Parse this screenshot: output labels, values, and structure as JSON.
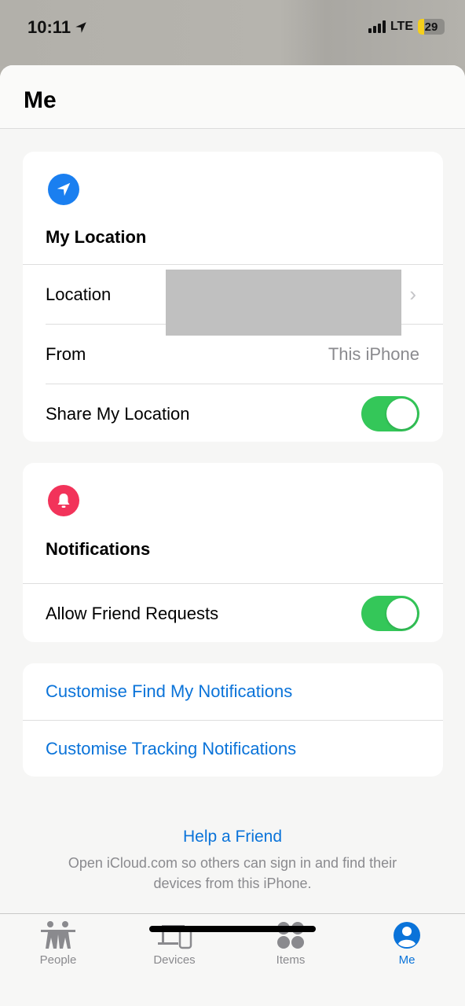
{
  "status_bar": {
    "time": "10:11",
    "network": "LTE",
    "battery": "29"
  },
  "header": {
    "title": "Me"
  },
  "my_location": {
    "title": "My Location",
    "rows": [
      {
        "label": "Location",
        "value": ""
      },
      {
        "label": "From",
        "value": "This iPhone"
      },
      {
        "label": "Share My Location",
        "toggle": true
      }
    ]
  },
  "notifications": {
    "title": "Notifications",
    "rows": [
      {
        "label": "Allow Friend Requests",
        "toggle": true
      }
    ]
  },
  "links": {
    "customise_find_my": "Customise Find My Notifications",
    "customise_tracking": "Customise Tracking Notifications"
  },
  "help": {
    "title": "Help a Friend",
    "description": "Open iCloud.com so others can sign in and find their devices from this iPhone."
  },
  "tabs": [
    {
      "label": "People",
      "icon": "people-icon"
    },
    {
      "label": "Devices",
      "icon": "devices-icon"
    },
    {
      "label": "Items",
      "icon": "items-icon"
    },
    {
      "label": "Me",
      "icon": "me-icon",
      "active": true
    }
  ],
  "colors": {
    "accent": "#0a73d9",
    "toggle_on": "#34c759",
    "location_icon": "#1a7ff0",
    "notification_icon": "#f2335a"
  }
}
